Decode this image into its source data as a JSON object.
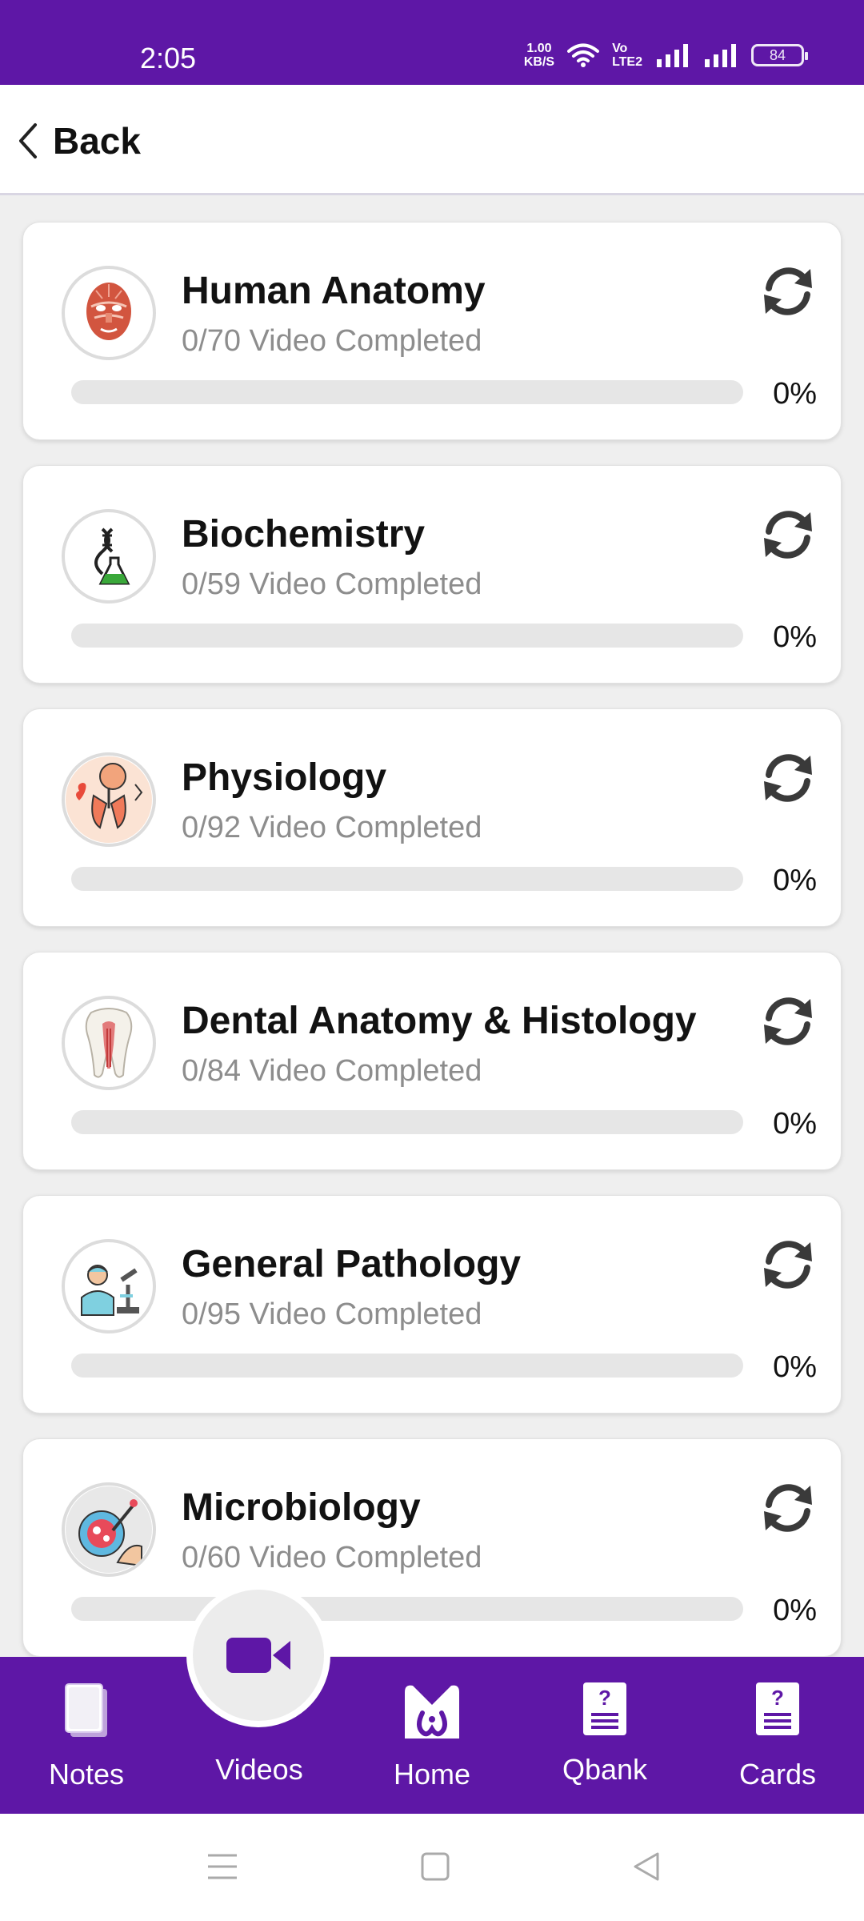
{
  "status_bar": {
    "time": "2:05",
    "speed_value": "1.00",
    "speed_unit": "KB/S",
    "volte_top": "Vo",
    "volte_bottom": "LTE2",
    "battery": "84"
  },
  "header": {
    "back_label": "Back"
  },
  "subjects": [
    {
      "title": "Human Anatomy",
      "progress_text": "0/70 Video Completed",
      "percent_label": "0%",
      "progress": 0,
      "icon": "muscle-face-icon"
    },
    {
      "title": "Biochemistry",
      "progress_text": "0/59 Video Completed",
      "percent_label": "0%",
      "progress": 0,
      "icon": "dna-flask-icon"
    },
    {
      "title": "Physiology",
      "progress_text": "0/92 Video Completed",
      "percent_label": "0%",
      "progress": 0,
      "icon": "lungs-person-icon"
    },
    {
      "title": "Dental Anatomy & Histology",
      "progress_text": "0/84 Video Completed",
      "percent_label": "0%",
      "progress": 0,
      "icon": "tooth-icon"
    },
    {
      "title": "General Pathology",
      "progress_text": "0/95 Video Completed",
      "percent_label": "0%",
      "progress": 0,
      "icon": "doctor-microscope-icon"
    },
    {
      "title": "Microbiology",
      "progress_text": "0/60 Video Completed",
      "percent_label": "0%",
      "progress": 0,
      "icon": "petri-dish-icon"
    }
  ],
  "bottom_nav": {
    "notes": "Notes",
    "videos": "Videos",
    "home": "Home",
    "qbank": "Qbank",
    "cards": "Cards"
  },
  "colors": {
    "brand": "#5e17a6",
    "progress_track": "#e6e6e6",
    "subtitle": "#8d8d8d"
  }
}
